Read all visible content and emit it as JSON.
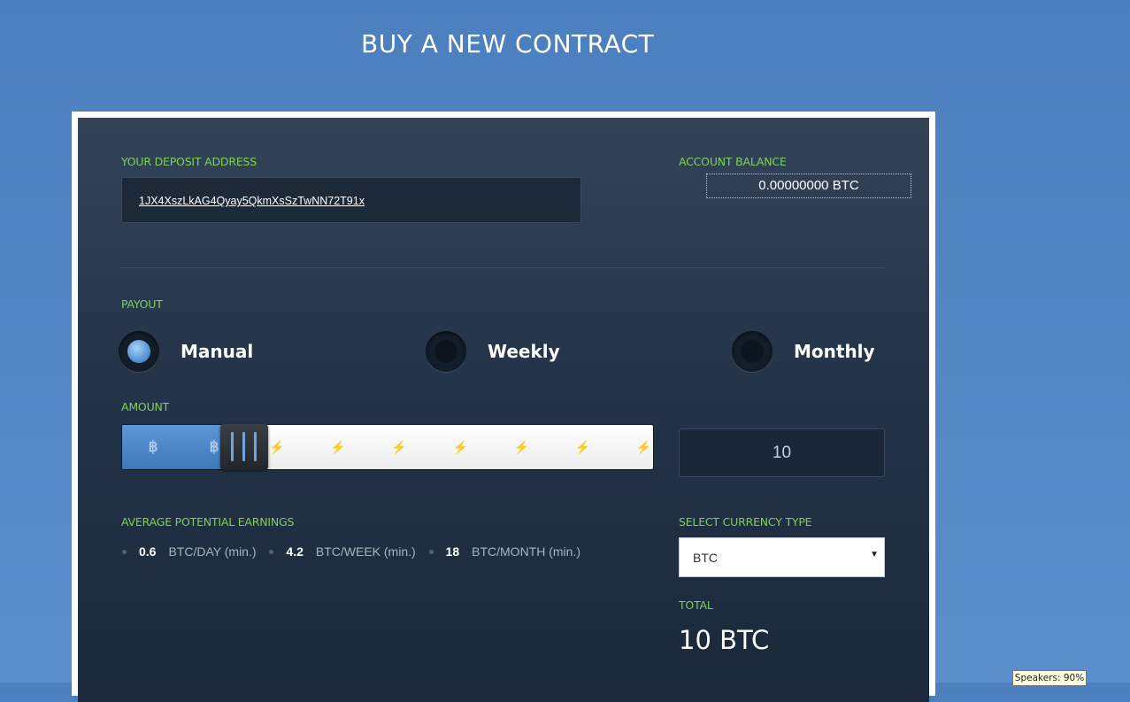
{
  "page": {
    "title": "BUY A NEW CONTRACT"
  },
  "deposit": {
    "label": "YOUR DEPOSIT ADDRESS",
    "address": "1JX4XszLkAG4Qyay5QkmXsSzTwNN72T91x"
  },
  "balance": {
    "label": "ACCOUNT BALANCE",
    "value": "0.00000000 BTC"
  },
  "payout": {
    "label": "PAYOUT",
    "options": [
      {
        "label": "Manual",
        "selected": true
      },
      {
        "label": "Weekly",
        "selected": false
      },
      {
        "label": "Monthly",
        "selected": false
      }
    ]
  },
  "amount": {
    "label": "AMOUNT",
    "value": "10",
    "slider_steps": 9,
    "slider_level_steps": 2,
    "filled_icon": "bitcoin-icon",
    "empty_icon": "lightning-icon"
  },
  "earnings": {
    "label": "AVERAGE POTENTIAL EARNINGS",
    "items": [
      {
        "value": "0.6",
        "unit": "BTC/DAY (min.)"
      },
      {
        "value": "4.2",
        "unit": "BTC/WEEK (min.)"
      },
      {
        "value": "18",
        "unit": "BTC/MONTH (min.)"
      }
    ]
  },
  "currency": {
    "label": "SELECT CURRENCY TYPE",
    "selected": "BTC"
  },
  "total": {
    "label": "TOTAL",
    "value": "10 BTC"
  },
  "tooltip": {
    "text": "Speakers: 90%"
  },
  "colors": {
    "accent_label": "#7fd05a",
    "radio_on": "#5d9ad9",
    "slider_fill": "#4a85c8",
    "background": "#5a8fcc"
  }
}
